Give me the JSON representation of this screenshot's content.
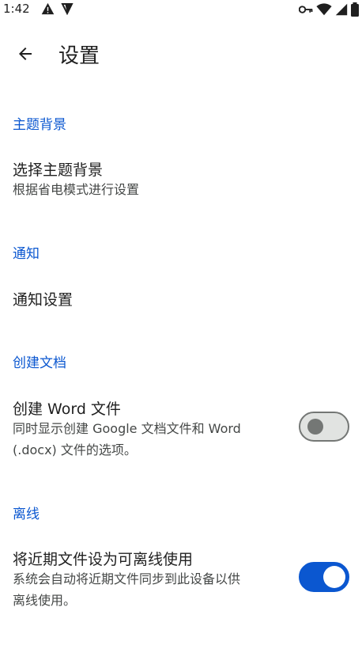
{
  "status_bar": {
    "time": "1:42"
  },
  "header": {
    "title": "设置"
  },
  "sections": {
    "theme": {
      "header": "主题背景",
      "item_title": "选择主题背景",
      "item_subtitle": "根据省电模式进行设置"
    },
    "notifications": {
      "header": "通知",
      "item_title": "通知设置"
    },
    "create_docs": {
      "header": "创建文档",
      "item_title": "创建 Word 文件",
      "item_subtitle_line1": "同时显示创建 Google 文档文件和 Word",
      "item_subtitle_line2": "(.docx) 文件的选项。",
      "toggle_on": false
    },
    "offline": {
      "header": "离线",
      "item_title": "将近期文件设为可离线使用",
      "item_subtitle_line1": "系统会自动将近期文件同步到此设备以供",
      "item_subtitle_line2": "离线使用。",
      "toggle_on": true
    }
  },
  "colors": {
    "accent": "#0b57d0",
    "text_primary": "#1f1f1f",
    "text_secondary": "#444746",
    "toggle_off_track": "#e1e3e1",
    "toggle_off_outline": "#747775"
  }
}
